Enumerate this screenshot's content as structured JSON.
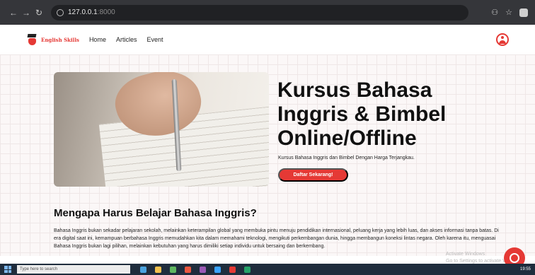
{
  "browser": {
    "url_host": "127.0.0.1",
    "url_port": ":8000"
  },
  "header": {
    "logo_text": "English Skills",
    "nav": [
      "Home",
      "Articles",
      "Event"
    ]
  },
  "hero": {
    "title": "Kursus Bahasa Inggris & Bimbel Online/Offline",
    "subtitle": "Kursus Bahasa Inggris dan Bimbel Dengan Harga Terjangkau.",
    "cta_label": "Daftar Sekarang!"
  },
  "section": {
    "title": "Mengapa Harus Belajar Bahasa Inggris?",
    "body": "Bahasa Inggris bukan sekadar pelajaran sekolah, melainkan keterampilan global yang membuka pintu menuju pendidikan internasional, peluang kerja yang lebih luas, dan akses informasi tanpa batas. Di era digital saat ini, kemampuan berbahasa Inggris memudahkan kita dalam memahami teknologi, mengikuti perkembangan dunia, hingga membangun koneksi lintas negara. Oleh karena itu, menguasai Bahasa Inggris bukan lagi pilihan, melainkan kebutuhan yang harus dimiliki setiap individu untuk bersaing dan berkembang."
  },
  "watermark": {
    "line1": "Activate Windows",
    "line2": "Go to Settings to activate Windows."
  },
  "taskbar": {
    "search_placeholder": "Type here to search",
    "time": "19:55"
  },
  "colors": {
    "accent": "#e53935",
    "browser_bar": "#35363a",
    "taskbar": "#1f2d3d"
  }
}
